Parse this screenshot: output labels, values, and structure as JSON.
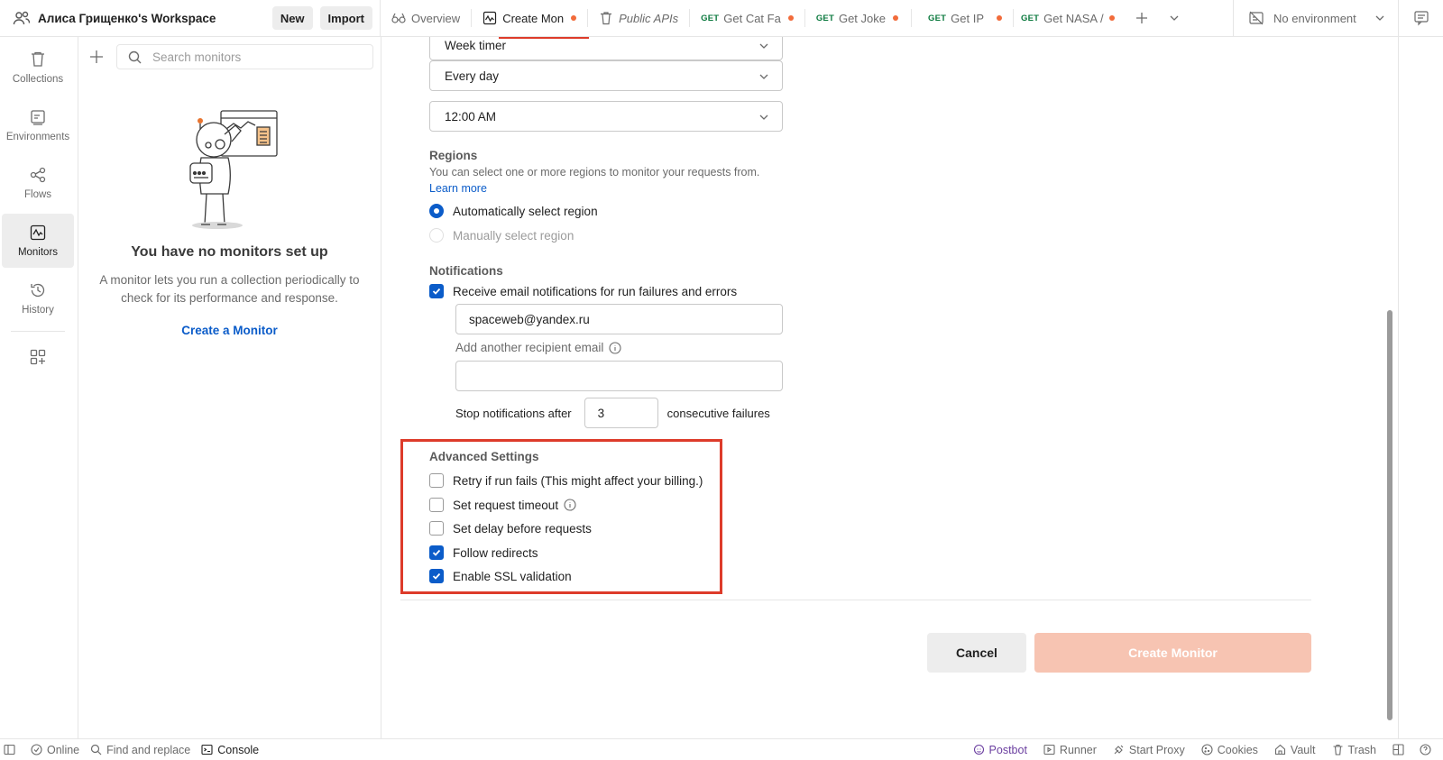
{
  "workspace": {
    "name": "Алиса Грищенко's Workspace",
    "new_label": "New",
    "import_label": "Import"
  },
  "tabs": [
    {
      "label": "Overview",
      "icon": "overview-icon",
      "method": "",
      "dirty": false,
      "italic": false
    },
    {
      "label": "Create Mon",
      "icon": "monitor-icon",
      "method": "",
      "dirty": true,
      "italic": false
    },
    {
      "label": "Public APIs",
      "icon": "trash-collection-icon",
      "method": "",
      "dirty": false,
      "italic": true
    },
    {
      "label": "Get Cat Fa",
      "icon": "",
      "method": "GET",
      "dirty": true,
      "italic": false
    },
    {
      "label": "Get Joke",
      "icon": "",
      "method": "GET",
      "dirty": true,
      "italic": false
    },
    {
      "label": "Get IP",
      "icon": "",
      "method": "GET",
      "dirty": true,
      "italic": false
    },
    {
      "label": "Get NASA /",
      "icon": "",
      "method": "GET",
      "dirty": true,
      "italic": false
    }
  ],
  "environment": {
    "label": "No environment"
  },
  "sidebar": {
    "items": [
      {
        "label": "Collections",
        "icon": "collections-icon",
        "active": false
      },
      {
        "label": "Environments",
        "icon": "environments-icon",
        "active": false
      },
      {
        "label": "Flows",
        "icon": "flows-icon",
        "active": false
      },
      {
        "label": "Monitors",
        "icon": "monitors-icon",
        "active": true
      },
      {
        "label": "History",
        "icon": "history-icon",
        "active": false
      }
    ]
  },
  "monitors_panel": {
    "search_placeholder": "Search monitors",
    "empty_title": "You have no monitors set up",
    "empty_desc": "A monitor lets you run a collection periodically to check for its performance and response.",
    "create_link": "Create a Monitor"
  },
  "form": {
    "timer_partial": "Week timer",
    "frequency": "Every day",
    "time": "12:00 AM",
    "regions": {
      "title": "Regions",
      "desc": "You can select one or more regions to monitor your requests from.",
      "learn_more": "Learn more",
      "options": [
        {
          "label": "Automatically select region",
          "selected": true,
          "disabled": false
        },
        {
          "label": "Manually select region",
          "selected": false,
          "disabled": true
        }
      ]
    },
    "notifications": {
      "title": "Notifications",
      "email_checkbox": "Receive email notifications for run failures and errors",
      "email_checked": true,
      "email_value": "spaceweb@yandex.ru",
      "add_recipient_label": "Add another recipient email",
      "add_recipient_value": "",
      "stop_prefix": "Stop notifications after",
      "stop_value": "3",
      "stop_suffix": "consecutive failures"
    },
    "advanced": {
      "title": "Advanced Settings",
      "options": [
        {
          "label": "Retry if run fails (This might affect your billing.)",
          "checked": false,
          "info": false
        },
        {
          "label": "Set request timeout",
          "checked": false,
          "info": true
        },
        {
          "label": "Set delay before requests",
          "checked": false,
          "info": false
        },
        {
          "label": "Follow redirects",
          "checked": true,
          "info": false
        },
        {
          "label": "Enable SSL validation",
          "checked": true,
          "info": false
        }
      ]
    },
    "cancel_label": "Cancel",
    "create_label": "Create Monitor"
  },
  "statusbar": {
    "online": "Online",
    "find_replace": "Find and replace",
    "console": "Console",
    "postbot": "Postbot",
    "runner": "Runner",
    "start_proxy": "Start Proxy",
    "cookies": "Cookies",
    "vault": "Vault",
    "trash": "Trash"
  },
  "colors": {
    "accent": "#0b5cc9",
    "highlight": "#dd3b2a",
    "create_disabled": "#f7c4b2",
    "dirty_dot": "#f26b3a",
    "get_method": "#0c7a3f"
  }
}
